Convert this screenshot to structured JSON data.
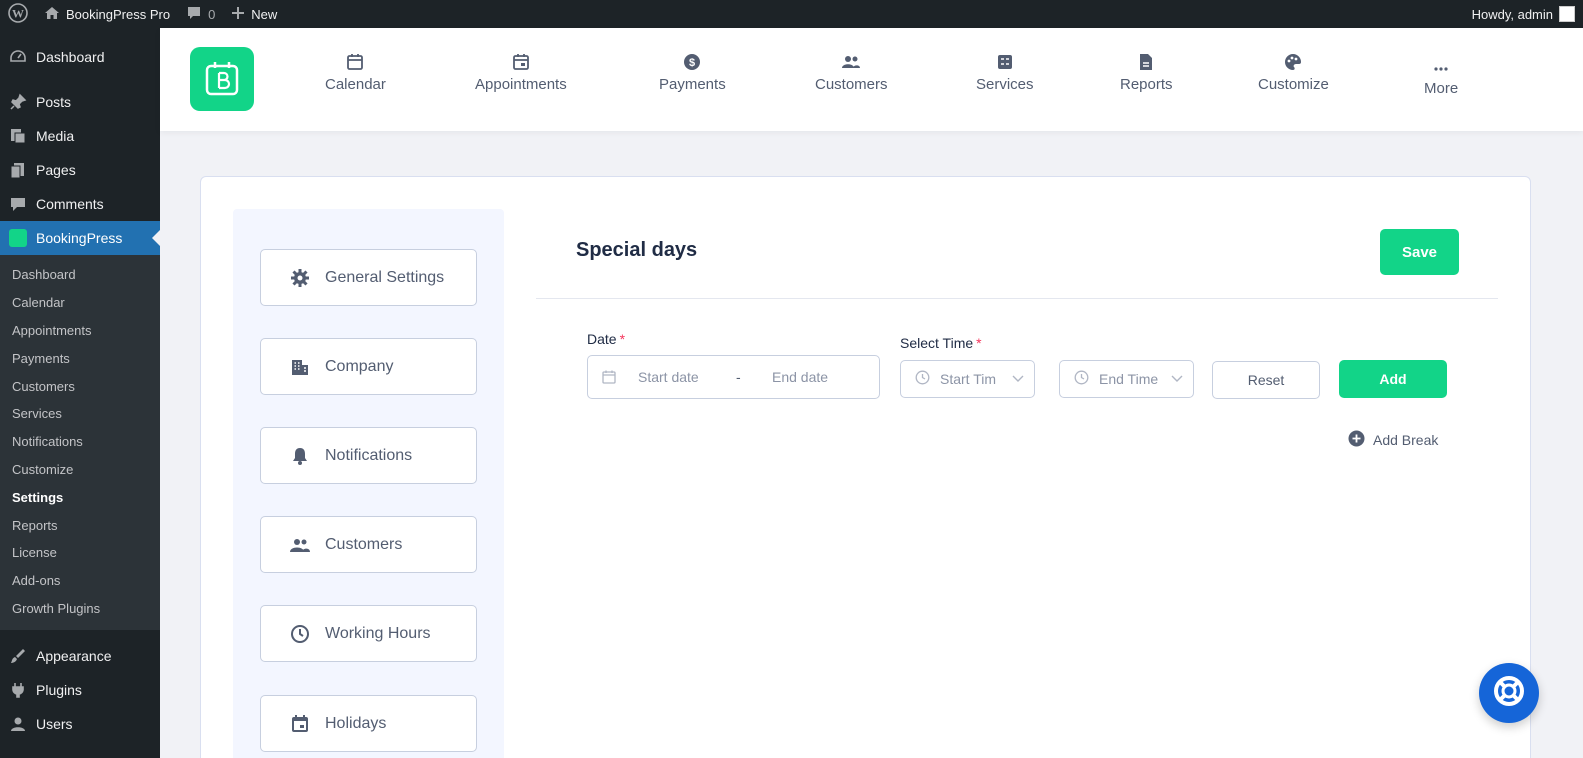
{
  "adminbar": {
    "site_name": "BookingPress Pro",
    "comments_count": "0",
    "new_label": "New",
    "howdy": "Howdy, admin"
  },
  "wp_menu": {
    "top_items": [
      {
        "label": "Dashboard",
        "icon": "dashboard-icon"
      },
      {
        "label": "Posts",
        "icon": "pin-icon"
      },
      {
        "label": "Media",
        "icon": "media-icon"
      },
      {
        "label": "Pages",
        "icon": "pages-icon"
      },
      {
        "label": "Comments",
        "icon": "comment-icon"
      }
    ],
    "active_item": "BookingPress",
    "submenu": [
      "Dashboard",
      "Calendar",
      "Appointments",
      "Payments",
      "Customers",
      "Services",
      "Notifications",
      "Customize",
      "Settings",
      "Reports",
      "License",
      "Add-ons",
      "Growth Plugins"
    ],
    "current_submenu": "Settings",
    "bottom_items": [
      {
        "label": "Appearance",
        "icon": "brush-icon"
      },
      {
        "label": "Plugins",
        "icon": "plug-icon"
      },
      {
        "label": "Users",
        "icon": "user-icon"
      }
    ]
  },
  "topnav": {
    "items": [
      {
        "label": "Calendar",
        "icon": "calendar-icon"
      },
      {
        "label": "Appointments",
        "icon": "calendar-check-icon"
      },
      {
        "label": "Payments",
        "icon": "dollar-icon"
      },
      {
        "label": "Customers",
        "icon": "customers-icon"
      },
      {
        "label": "Services",
        "icon": "services-icon"
      },
      {
        "label": "Reports",
        "icon": "report-icon"
      },
      {
        "label": "Customize",
        "icon": "palette-icon"
      },
      {
        "label": "More",
        "icon": "more-dots-icon"
      }
    ]
  },
  "settings_menu": [
    {
      "label": "General Settings",
      "icon": "gear-icon"
    },
    {
      "label": "Company",
      "icon": "building-icon"
    },
    {
      "label": "Notifications",
      "icon": "bell-icon"
    },
    {
      "label": "Customers",
      "icon": "customers-icon"
    },
    {
      "label": "Working Hours",
      "icon": "clock-icon"
    },
    {
      "label": "Holidays",
      "icon": "calendar-icon"
    }
  ],
  "main": {
    "title": "Special days",
    "save_label": "Save",
    "date_label": "Date",
    "required_mark": "*",
    "start_date_placeholder": "Start date",
    "date_separator": "-",
    "end_date_placeholder": "End date",
    "time_label": "Select Time",
    "start_time_placeholder": "Start Tim",
    "end_time_placeholder": "End Time",
    "reset_label": "Reset",
    "add_label": "Add",
    "add_break_label": "Add Break"
  },
  "colors": {
    "brand_green": "#12d488",
    "wp_active_blue": "#2271b1",
    "help_blue": "#1565d8"
  }
}
